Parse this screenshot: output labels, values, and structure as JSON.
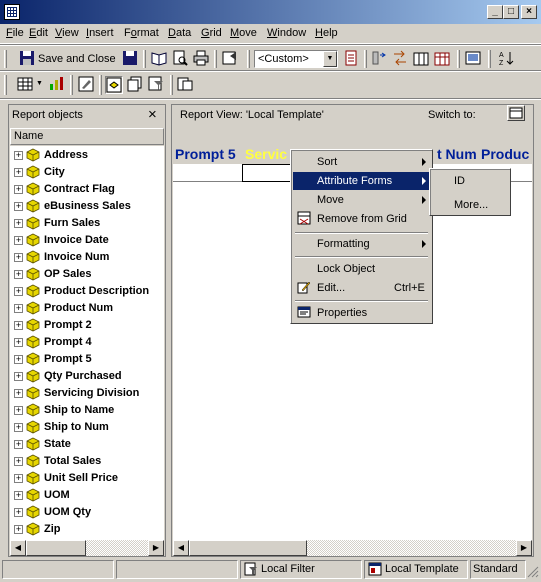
{
  "window": {
    "title": "",
    "buttons": {
      "minimize": "_",
      "maximize": "□",
      "close": "×"
    }
  },
  "menu": [
    "File",
    "Edit",
    "View",
    "Insert",
    "Format",
    "Data",
    "Grid",
    "Move",
    "Window",
    "Help"
  ],
  "menu_mnemonics": [
    "F",
    "E",
    "V",
    "I",
    "o",
    "D",
    "G",
    "M",
    "W",
    "H"
  ],
  "toolbar": {
    "save_close_label": "Save and Close",
    "template_select": "<Custom>"
  },
  "left_panel": {
    "title": "Report objects",
    "column_header": "Name",
    "objects": [
      "Address",
      "City",
      "Contract Flag",
      "eBusiness Sales",
      "Furn Sales",
      "Invoice Date",
      "Invoice Num",
      "OP Sales",
      "Product Description",
      "Product Num",
      "Prompt 2",
      "Prompt 4",
      "Prompt 5",
      "Qty Purchased",
      "Servicing Division",
      "Ship to Name",
      "Ship to Num",
      "State",
      "Total Sales",
      "Unit Sell Price",
      "UOM",
      "UOM Qty",
      "Zip"
    ]
  },
  "right_panel": {
    "view_label": "Report View: 'Local Template'",
    "switch_to": "Switch to:",
    "grid_headers": [
      "Prompt 5",
      "Servic",
      "t Num",
      "Produc"
    ]
  },
  "context_menu": {
    "items": [
      {
        "label": "Sort",
        "submenu": true
      },
      {
        "label": "Attribute Forms",
        "submenu": true,
        "selected": true
      },
      {
        "label": "Move",
        "submenu": true
      },
      {
        "label": "Remove from Grid",
        "icon": "remove-grid-icon"
      },
      {
        "label": "Formatting",
        "submenu": true
      },
      {
        "label": "Lock Object"
      },
      {
        "label": "Edit...",
        "shortcut": "Ctrl+E",
        "icon": "edit-icon"
      },
      {
        "label": "Properties",
        "icon": "properties-icon"
      }
    ],
    "submenu": [
      "ID",
      "More..."
    ]
  },
  "status_bar": {
    "filter": "Local Filter",
    "template": "Local Template",
    "mode": "Standard"
  },
  "colors": {
    "title_bar": "#0a246a",
    "selection": "#0a246a",
    "grid_header_text": "#001f99",
    "cube_yellow": "#e6d600"
  }
}
